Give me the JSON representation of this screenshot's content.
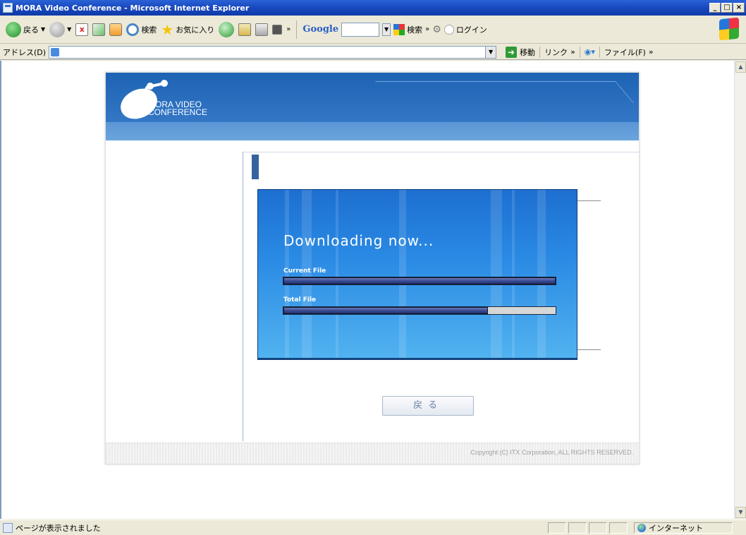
{
  "window": {
    "title": "MORA Video Conference - Microsoft Internet Explorer",
    "buttons": [
      "_",
      "□",
      "×"
    ]
  },
  "toolbar": {
    "back_label": "戻る",
    "search_label": "検索",
    "favorites_label": "お気に入り",
    "google_label": "Google",
    "google_search_label": "検索",
    "login_label": "ログイン",
    "chevron": "»",
    "icons": [
      "back-arrow-icon",
      "forward-arrow-icon",
      "stop-icon",
      "refresh-icon",
      "home-icon",
      "search-icon",
      "favorites-star-icon",
      "history-icon",
      "mail-icon",
      "print-icon",
      "edit-icon"
    ]
  },
  "addressbar": {
    "label": "アドレス(D)",
    "value": "",
    "go_label": "移動",
    "links_label": "リンク",
    "file_menu_label": "ファイル(F)",
    "chevron": "»"
  },
  "page": {
    "logo_line1": "MORA VIDEO",
    "logo_line2": "CONFERENCE",
    "download": {
      "title": "Downloading now...",
      "current_label": "Current File",
      "current_progress": 1.0,
      "total_label": "Total File",
      "total_progress": 0.75
    },
    "back_button_label": "戻る",
    "copyright": "Copyright (C) ITX Corporation, ALL RIGHTS RESERVED."
  },
  "statusbar": {
    "message": "ページが表示されました",
    "zone": "インターネット"
  },
  "colors": {
    "title_bar": "#1a4ac0",
    "header_blue": "#2f73c2",
    "panel_blue": "#2a8ae4",
    "progress_fill": "#3a4c95"
  }
}
